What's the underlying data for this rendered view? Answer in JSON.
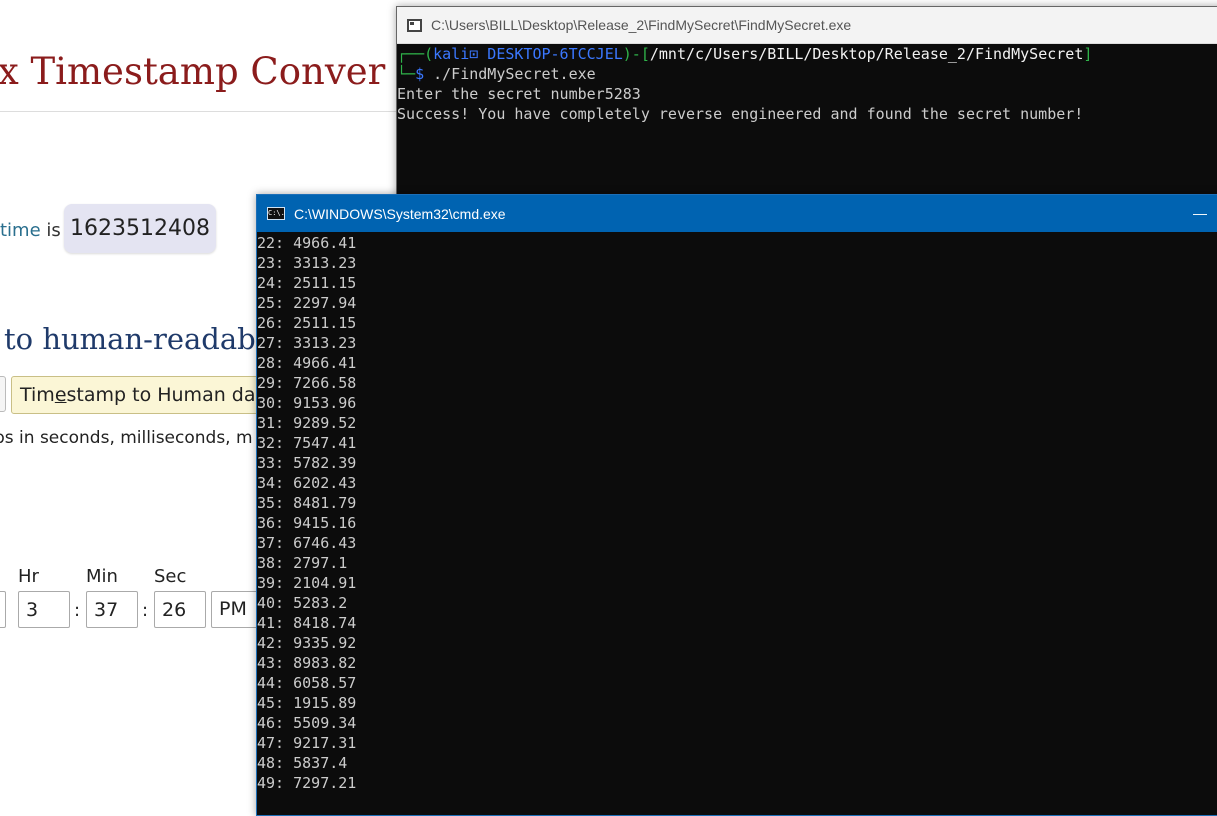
{
  "background_page": {
    "title": "ix Timestamp Conver",
    "epoch_prefix_link": "time",
    "epoch_prefix_text": " is",
    "epoch_value": "1623512408",
    "section_heading": "to human-readab",
    "convert_button": {
      "before": "Tim",
      "underlined": "e",
      "after": "stamp to Human date"
    },
    "hint_text": "ps in seconds, milliseconds, m",
    "labels": {
      "hr": "Hr",
      "min": "Min",
      "sec": "Sec"
    },
    "inputs": {
      "hr": "3",
      "min": "37",
      "sec": "26",
      "ampm": "PM"
    },
    "colon": ":"
  },
  "kali_window": {
    "title": "C:\\Users\\BILL\\Desktop\\Release_2\\FindMySecret\\FindMySecret.exe",
    "prompt": {
      "open": "┌──(",
      "user": "kali⊡ DESKTOP-6TCCJEL",
      "mid": ")-[",
      "path": "/mnt/c/Users/BILL/Desktop/Release_2/FindMySecret",
      "close": "]",
      "line2_prefix": "└─",
      "dollar": "$",
      "command": " ./FindMySecret.exe"
    },
    "output": [
      "Enter the secret number5283",
      "Success! You have completely reverse engineered and found the secret number!"
    ]
  },
  "cmd_window": {
    "title": "C:\\WINDOWS\\System32\\cmd.exe",
    "icon_text": "C:\\.",
    "minimize_glyph": "—",
    "lines": [
      "22: 4966.41",
      "23: 3313.23",
      "24: 2511.15",
      "25: 2297.94",
      "26: 2511.15",
      "27: 3313.23",
      "28: 4966.41",
      "29: 7266.58",
      "30: 9153.96",
      "31: 9289.52",
      "32: 7547.41",
      "33: 5782.39",
      "34: 6202.43",
      "35: 8481.79",
      "36: 9415.16",
      "37: 6746.43",
      "38: 2797.1",
      "39: 2104.91",
      "40: 5283.2",
      "41: 8418.74",
      "42: 9335.92",
      "43: 8983.82",
      "44: 6058.57",
      "45: 1915.89",
      "46: 5509.34",
      "47: 9217.31",
      "48: 5837.4",
      "49: 7297.21"
    ]
  }
}
